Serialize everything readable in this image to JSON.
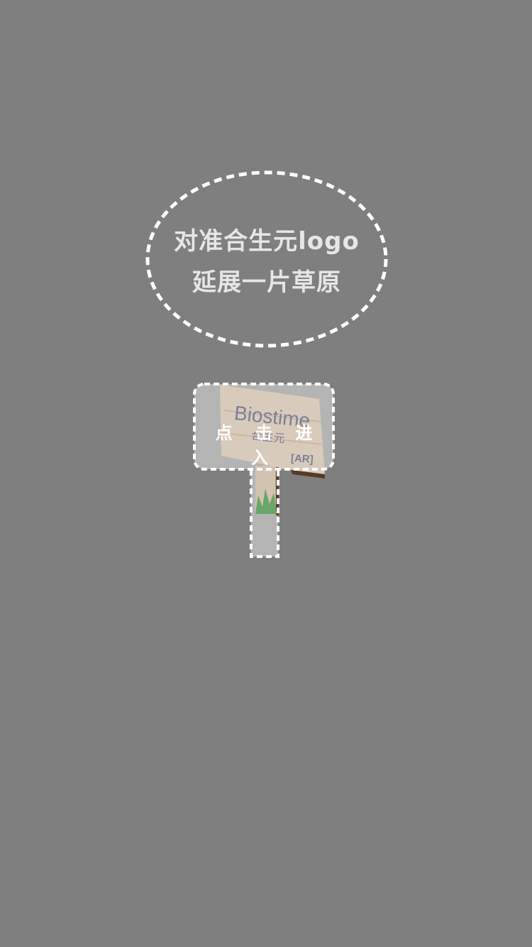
{
  "scan_hint": {
    "line1": "对准合生元logo",
    "line2": "延展一片草原"
  },
  "signboard": {
    "brand_en": "Biostime",
    "brand_cn": "合生元",
    "badge": "[AR]",
    "enter_label": "点 击 进 入"
  },
  "colors": {
    "overlay": "#7f7f7f",
    "dashed_border": "#ffffff",
    "hint_text": "#e6e6e6",
    "board_wood": "#d9cbbb",
    "grass": "#6aa56a"
  }
}
